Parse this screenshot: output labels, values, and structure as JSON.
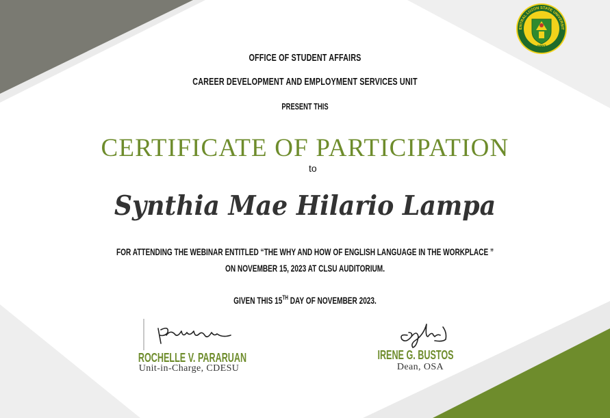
{
  "header": {
    "office": "OFFICE OF STUDENT AFFAIRS",
    "unit": "CAREER DEVELOPMENT AND EMPLOYMENT SERVICES UNIT",
    "present": "PRESENT THIS"
  },
  "certificate": {
    "title": "CERTIFICATE OF PARTICIPATION",
    "to": "to",
    "recipient": "Synthia Mae Hilario Lampa",
    "body_line1": "FOR ATTENDING THE WEBINAR ENTITLED “THE WHY AND HOW OF ENGLISH LANGUAGE IN THE WORKPLACE ”",
    "body_line2": "ON NOVEMBER 15, 2023 AT CLSU AUDITORIUM.",
    "given_prefix": "GIVEN THIS 15",
    "given_sup": "TH",
    "given_suffix": " DAY OF NOVEMBER 2023."
  },
  "logo": {
    "ring_text": "CENTRAL LUZON STATE UNIVERSITY",
    "founded": "1907"
  },
  "signatories": [
    {
      "name": "ROCHELLE V. PARARUAN",
      "title": "Unit-in-Charge, CDESU"
    },
    {
      "name": "IRENE G. BUSTOS",
      "title": "Dean, OSA"
    }
  ],
  "colors": {
    "accent_green": "#6e8c2c",
    "corner_gray": "#7a7a72",
    "corner_light": "#ededed"
  }
}
